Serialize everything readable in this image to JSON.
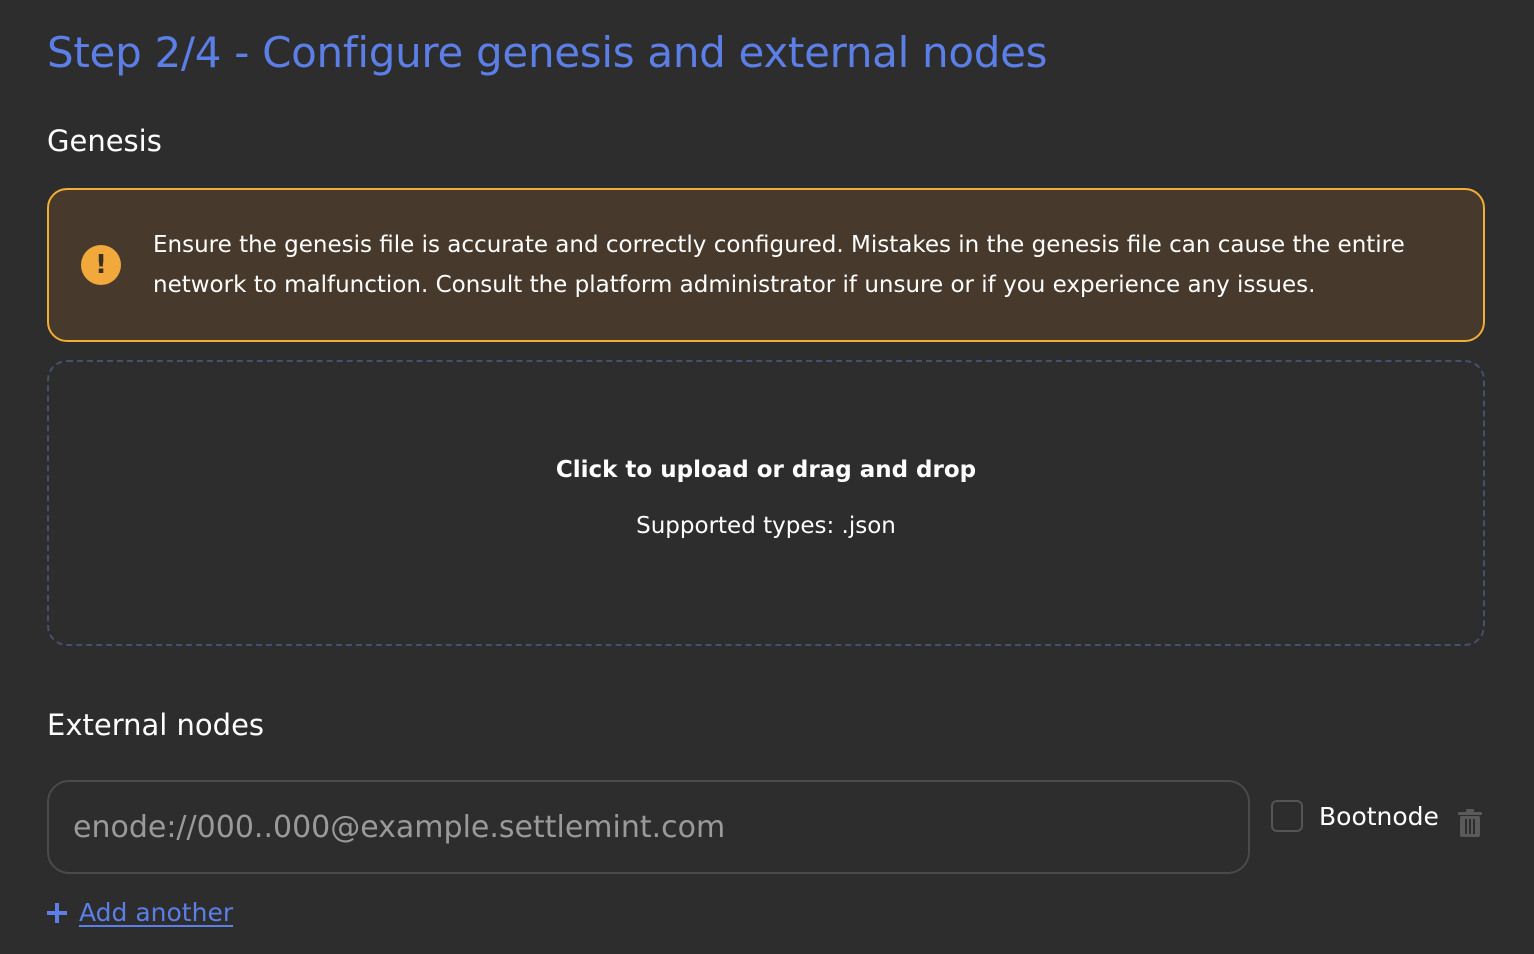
{
  "header": {
    "title": "Step 2/4 - Configure genesis and external nodes"
  },
  "genesis": {
    "heading": "Genesis",
    "warning": {
      "icon": "exclamation-icon",
      "text": "Ensure the genesis file is accurate and correctly configured. Mistakes in the genesis file can cause the entire network to malfunction. Consult the platform administrator if unsure or if you experience any issues."
    },
    "dropzone": {
      "title": "Click to upload or drag and drop",
      "subtitle": "Supported types: .json"
    }
  },
  "external_nodes": {
    "heading": "External nodes",
    "nodes": [
      {
        "value": "",
        "placeholder": "enode://000..000@example.settlemint.com",
        "bootnode_label": "Bootnode",
        "bootnode_checked": false
      }
    ],
    "add_another_label": "Add another"
  },
  "colors": {
    "background": "#2d2d2d",
    "accent": "#5b7fe6",
    "warning_bg": "#47392b",
    "warning_border": "#f1ae37"
  }
}
